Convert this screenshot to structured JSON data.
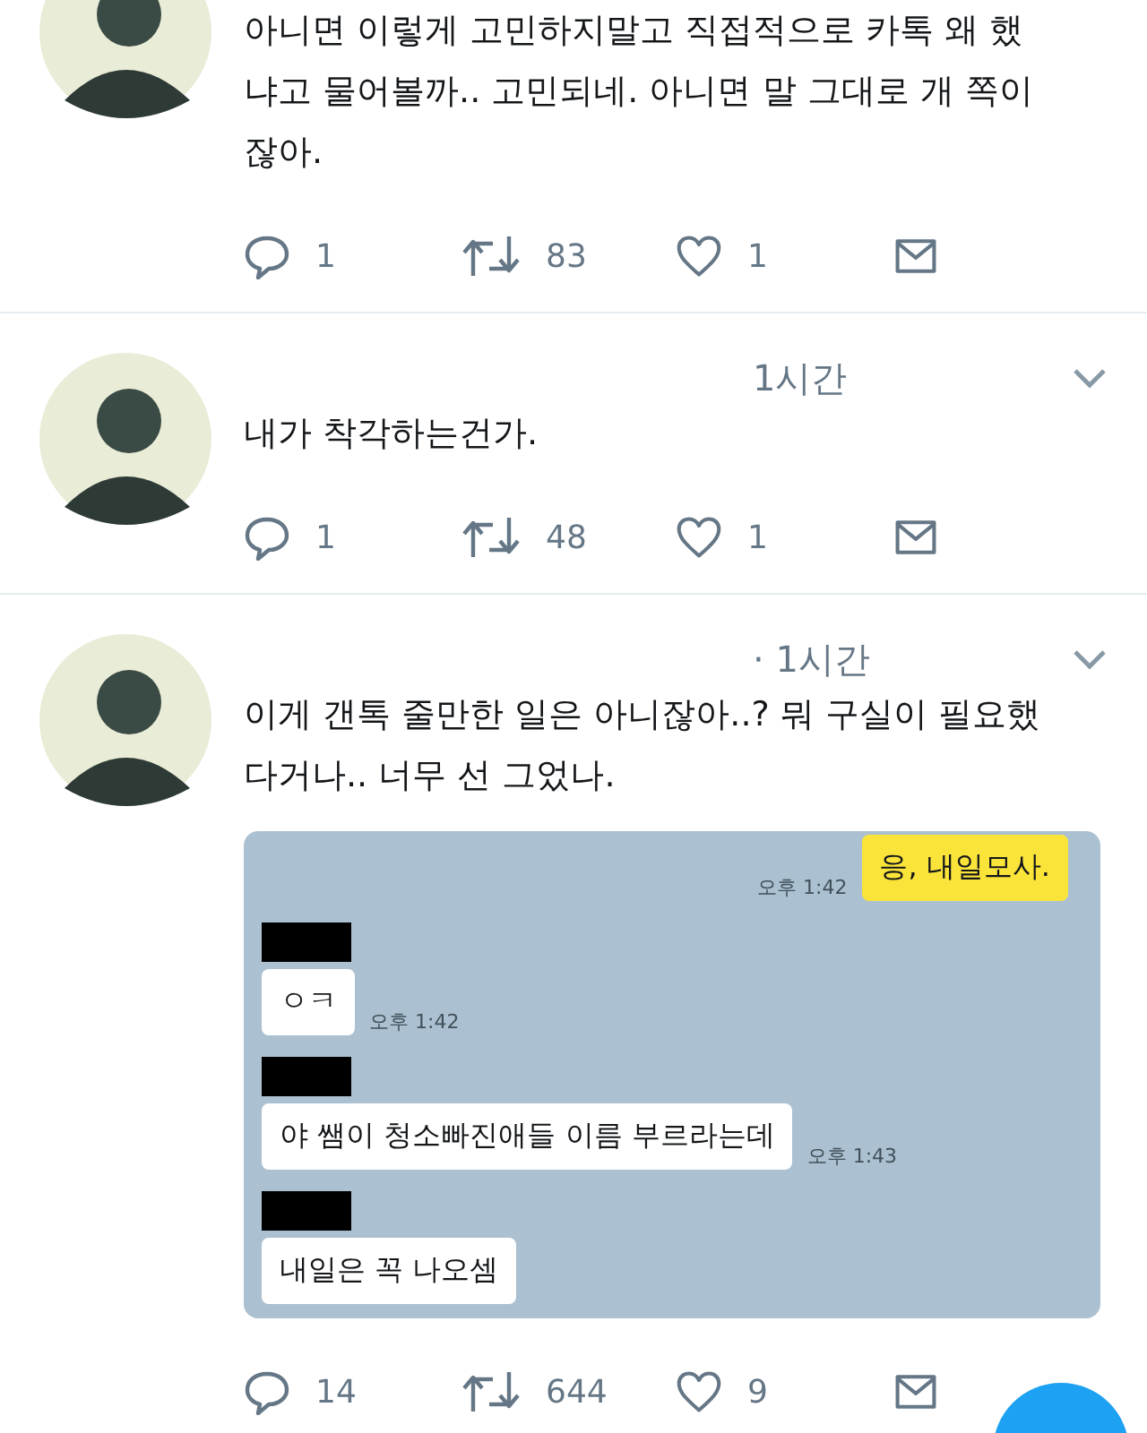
{
  "tweets": [
    {
      "text": "아니면 이렇게 고민하지말고 직접적으로 카톡 왜 했냐고 물어볼까.. 고민되네. 아니면 말 그대로 개 쪽이잖아.",
      "replies": "1",
      "retweets": "83",
      "likes": "1"
    },
    {
      "time": "1시간",
      "menu": true,
      "text": "내가 착각하는건가.",
      "replies": "1",
      "retweets": "48",
      "likes": "1"
    },
    {
      "time": "· 1시간",
      "menu": true,
      "text": "이게 갠톡 줄만한 일은 아니잖아..? 뭐 구실이 필요했다거나.. 너무 선 그었나.",
      "replies": "14",
      "retweets": "644",
      "likes": "9",
      "chat": [
        {
          "kind": "sent",
          "text": "응, 내일모사.",
          "time": "오후 1:42"
        },
        {
          "kind": "received",
          "text": "ㅇㅋ",
          "time": "오후 1:42"
        },
        {
          "kind": "received",
          "text": "야 쌤이 청소빠진애들 이름 부르라는데",
          "time": "오후 1:43"
        },
        {
          "kind": "received",
          "text": "내일은 꼭 나오셈"
        }
      ]
    }
  ]
}
